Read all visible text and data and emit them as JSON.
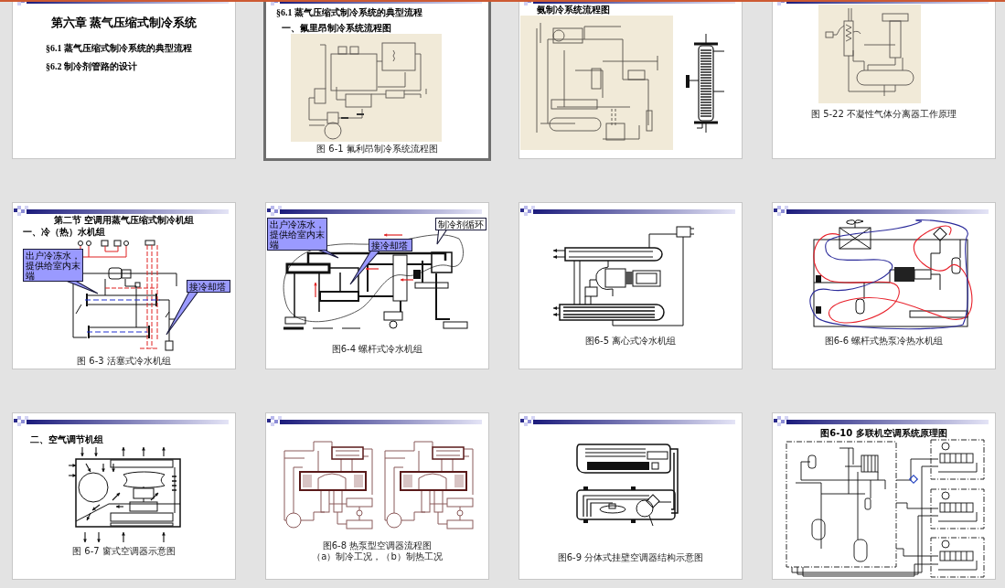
{
  "slides": [
    {
      "selected": false,
      "kind": "cover",
      "title": "第六章 蒸气压缩式制冷系统",
      "items": [
        "§6.1 蒸气压缩式制冷系统的典型流程",
        "§6.2 制冷剂管路的设计"
      ]
    },
    {
      "selected": true,
      "kind": "content",
      "title": "§6.1  蒸气压缩式制冷系统的典型流程",
      "subtitle": "一、氟里昂制冷系统流程图",
      "figures": [
        {
          "kind": "freon-scan"
        }
      ],
      "captions": [
        "图 6-1   氟利昂制冷系统流程图"
      ]
    },
    {
      "selected": false,
      "kind": "content",
      "title": "氨制冷系统流程图",
      "figures": [
        {
          "kind": "ammonia-scan"
        },
        {
          "kind": "coil-separator"
        }
      ]
    },
    {
      "selected": false,
      "kind": "content",
      "figures": [
        {
          "kind": "separator-scan"
        }
      ],
      "captions": [
        "图 5-22   不凝性气体分离器工作原理"
      ]
    },
    {
      "selected": false,
      "kind": "content",
      "title": "第二节  空调用蒸气压缩式制冷机组",
      "subtitle": "一、冷（热）水机组",
      "figures": [
        {
          "kind": "piston-chiller"
        }
      ],
      "captions": [
        "图 6-3   活塞式冷水机组"
      ],
      "callouts": [
        {
          "kind": "filled",
          "text": "出户冷冻水，提供给室内末端"
        },
        {
          "kind": "filled",
          "text": "接冷却塔"
        }
      ]
    },
    {
      "selected": false,
      "kind": "content",
      "figures": [
        {
          "kind": "screw-chiller"
        }
      ],
      "captions": [
        "图6-4  螺杆式冷水机组"
      ],
      "callouts": [
        {
          "kind": "filled",
          "text": "出户冷冻水，提供给室内末端"
        },
        {
          "kind": "outlined",
          "text": "制冷剂循环"
        },
        {
          "kind": "filled",
          "text": "接冷却塔"
        }
      ]
    },
    {
      "selected": false,
      "kind": "content",
      "figures": [
        {
          "kind": "centrifugal-chiller"
        }
      ],
      "captions": [
        "图6-5  离心式冷水机组"
      ]
    },
    {
      "selected": false,
      "kind": "content",
      "figures": [
        {
          "kind": "heat-pump-chiller"
        }
      ],
      "captions": [
        "图6-6  螺杆式热泵冷热水机组"
      ]
    },
    {
      "selected": false,
      "kind": "content",
      "subtitle": "二、空气调节机组",
      "figures": [
        {
          "kind": "window-unit"
        }
      ],
      "captions": [
        "图 6-7   窗式空调器示意图"
      ]
    },
    {
      "selected": false,
      "kind": "content",
      "figures": [
        {
          "kind": "reversing-valve"
        },
        {
          "kind": "reversing-valve"
        }
      ],
      "captions": [
        "图6-8   热泵型空调器流程图",
        "（a）制冷工况，（b）制热工况"
      ]
    },
    {
      "selected": false,
      "kind": "content",
      "figures": [
        {
          "kind": "split-unit"
        }
      ],
      "captions": [
        "图6-9   分体式挂壁空调器结构示意图"
      ]
    },
    {
      "selected": false,
      "kind": "content",
      "title": "图6-10  多联机空调系统原理图",
      "figures": [
        {
          "kind": "multi-split"
        }
      ]
    }
  ]
}
